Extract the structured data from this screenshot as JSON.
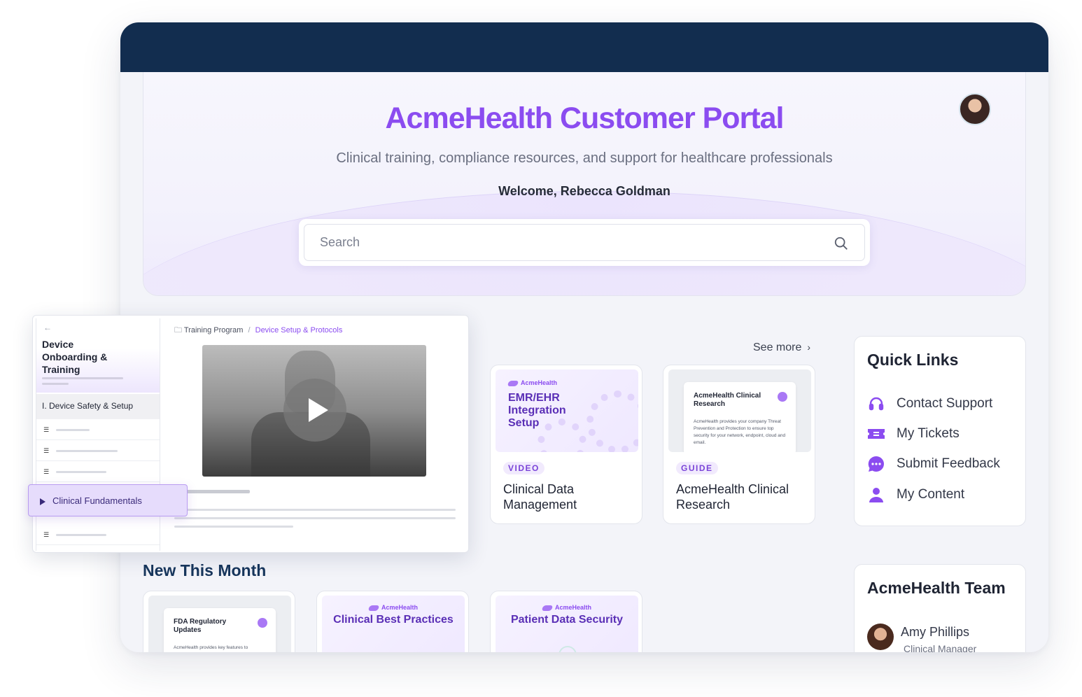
{
  "hero": {
    "title": "AcmeHealth Customer Portal",
    "subtitle": "Clinical training, compliance resources, and support for healthcare professionals",
    "welcome": "Welcome, Rebecca Goldman"
  },
  "search": {
    "placeholder": "Search"
  },
  "featured": {
    "see_more": "See more",
    "cards": [
      {
        "brand": "AcmeHealth",
        "thumb_title": "EMR/EHR Integration Setup",
        "badge": "VIDEO",
        "title": "Clinical Data Management"
      },
      {
        "doc_title": "AcmeHealth Clinical Research",
        "doc_text": "AcmeHealth provides your company Threat Prevention and Protection to ensure top security for your network, endpoint, cloud and email.",
        "badge": "GUIDE",
        "title": "AcmeHealth Clinical Research"
      }
    ]
  },
  "quick_links": {
    "title": "Quick Links",
    "items": [
      {
        "label": "Contact Support",
        "icon": "headset-icon"
      },
      {
        "label": "My Tickets",
        "icon": "ticket-icon"
      },
      {
        "label": "Submit Feedback",
        "icon": "chat-bubble-icon"
      },
      {
        "label": "My Content",
        "icon": "user-icon"
      }
    ]
  },
  "team": {
    "title": "AcmeHealth Team",
    "members": [
      {
        "name": "Amy Phillips",
        "role": "Clinical Manager"
      }
    ]
  },
  "new_this_month": {
    "title": "New This Month",
    "cards": [
      {
        "doc_title": "FDA Regulatory Updates",
        "doc_text": "AcmeHealth provides key features to administrators and stakeholders to"
      },
      {
        "brand": "AcmeHealth",
        "thumb_title": "Clinical Best Practices"
      },
      {
        "brand": "AcmeHealth",
        "thumb_title": "Patient Data Security"
      }
    ]
  },
  "training_panel": {
    "course_title": "Device Onboarding & Training",
    "section": "I. Device Safety & Setup",
    "breadcrumb": {
      "root": "Training Program",
      "separator": "/",
      "current": "Device Setup & Protocols"
    },
    "active_lesson": "Clinical Fundamentals"
  },
  "colors": {
    "accent": "#8b4cf0",
    "topbar": "#122d4f",
    "heading": "#17365c"
  }
}
